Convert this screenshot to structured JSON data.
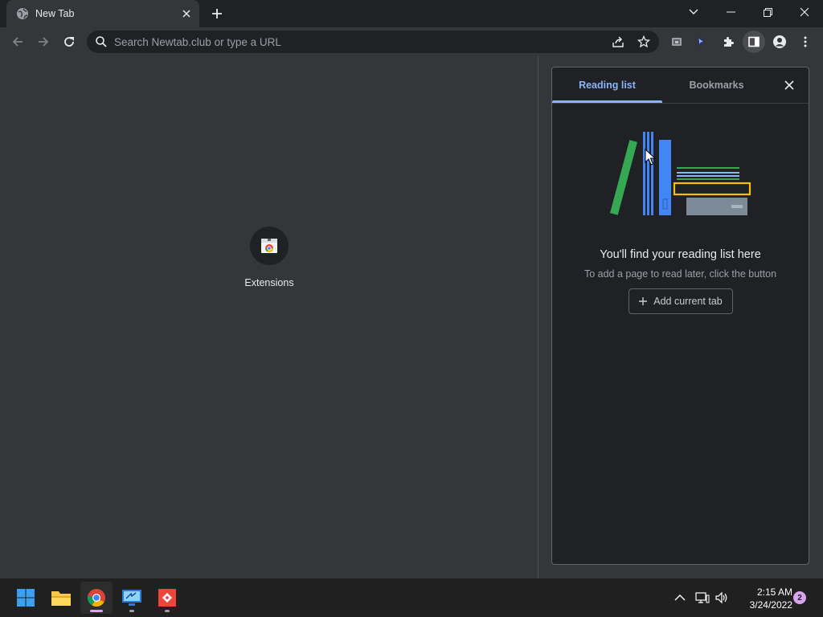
{
  "tab": {
    "title": "New Tab"
  },
  "omnibox": {
    "placeholder": "Search Newtab.club or type a URL"
  },
  "shortcut": {
    "label": "Extensions"
  },
  "side_panel": {
    "tabs": [
      {
        "label": "Reading list",
        "active": true
      },
      {
        "label": "Bookmarks",
        "active": false
      }
    ],
    "heading": "You'll find your reading list here",
    "subtext": "To add a page to read later, click the button",
    "add_button_label": "Add current tab"
  },
  "taskbar": {
    "time": "2:15 AM",
    "date": "3/24/2022",
    "notification_count": "2",
    "apps": [
      "start-icon",
      "file-explorer-icon",
      "chrome-icon",
      "remote-desktop-icon",
      "anydesk-icon"
    ]
  },
  "colors": {
    "accent": "#8ab4f8",
    "toolbar_bg": "#35363a",
    "frame_bg": "#202124",
    "panel_bg": "#202124"
  }
}
